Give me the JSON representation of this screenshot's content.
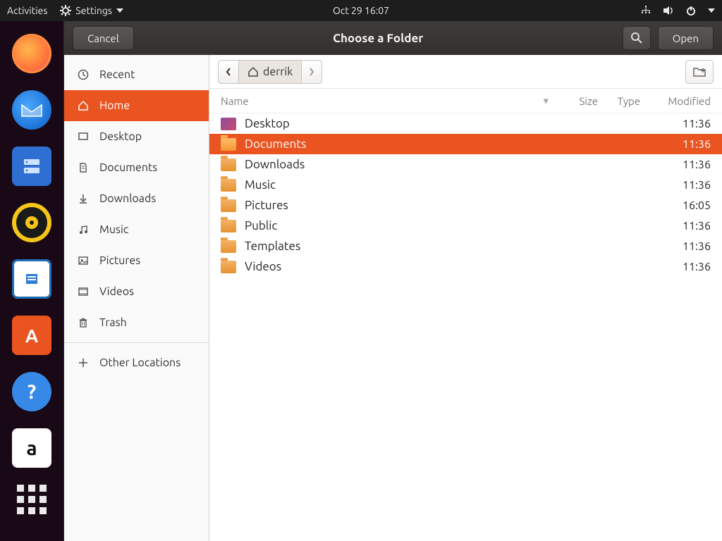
{
  "topbar": {
    "activities": "Activities",
    "app_label": "Settings",
    "clock": "Oct 29  16:07"
  },
  "dialog": {
    "cancel": "Cancel",
    "title": "Choose a Folder",
    "open": "Open"
  },
  "breadcrumb": {
    "user": "derrik"
  },
  "places": [
    {
      "icon": "clock",
      "label": "Recent"
    },
    {
      "icon": "home",
      "label": "Home",
      "selected": true
    },
    {
      "icon": "desktop",
      "label": "Desktop"
    },
    {
      "icon": "documents",
      "label": "Documents"
    },
    {
      "icon": "downloads",
      "label": "Downloads"
    },
    {
      "icon": "music",
      "label": "Music"
    },
    {
      "icon": "pictures",
      "label": "Pictures"
    },
    {
      "icon": "videos",
      "label": "Videos"
    },
    {
      "icon": "trash",
      "label": "Trash"
    }
  ],
  "other_locations": "Other Locations",
  "columns": {
    "name": "Name",
    "size": "Size",
    "type": "Type",
    "modified": "Modified"
  },
  "rows": [
    {
      "name": "Desktop",
      "modified": "11:36",
      "kind": "desktop"
    },
    {
      "name": "Documents",
      "modified": "11:36",
      "selected": true
    },
    {
      "name": "Downloads",
      "modified": "11:36"
    },
    {
      "name": "Music",
      "modified": "11:36"
    },
    {
      "name": "Pictures",
      "modified": "16:05"
    },
    {
      "name": "Public",
      "modified": "11:36"
    },
    {
      "name": "Templates",
      "modified": "11:36"
    },
    {
      "name": "Videos",
      "modified": "11:36"
    }
  ]
}
